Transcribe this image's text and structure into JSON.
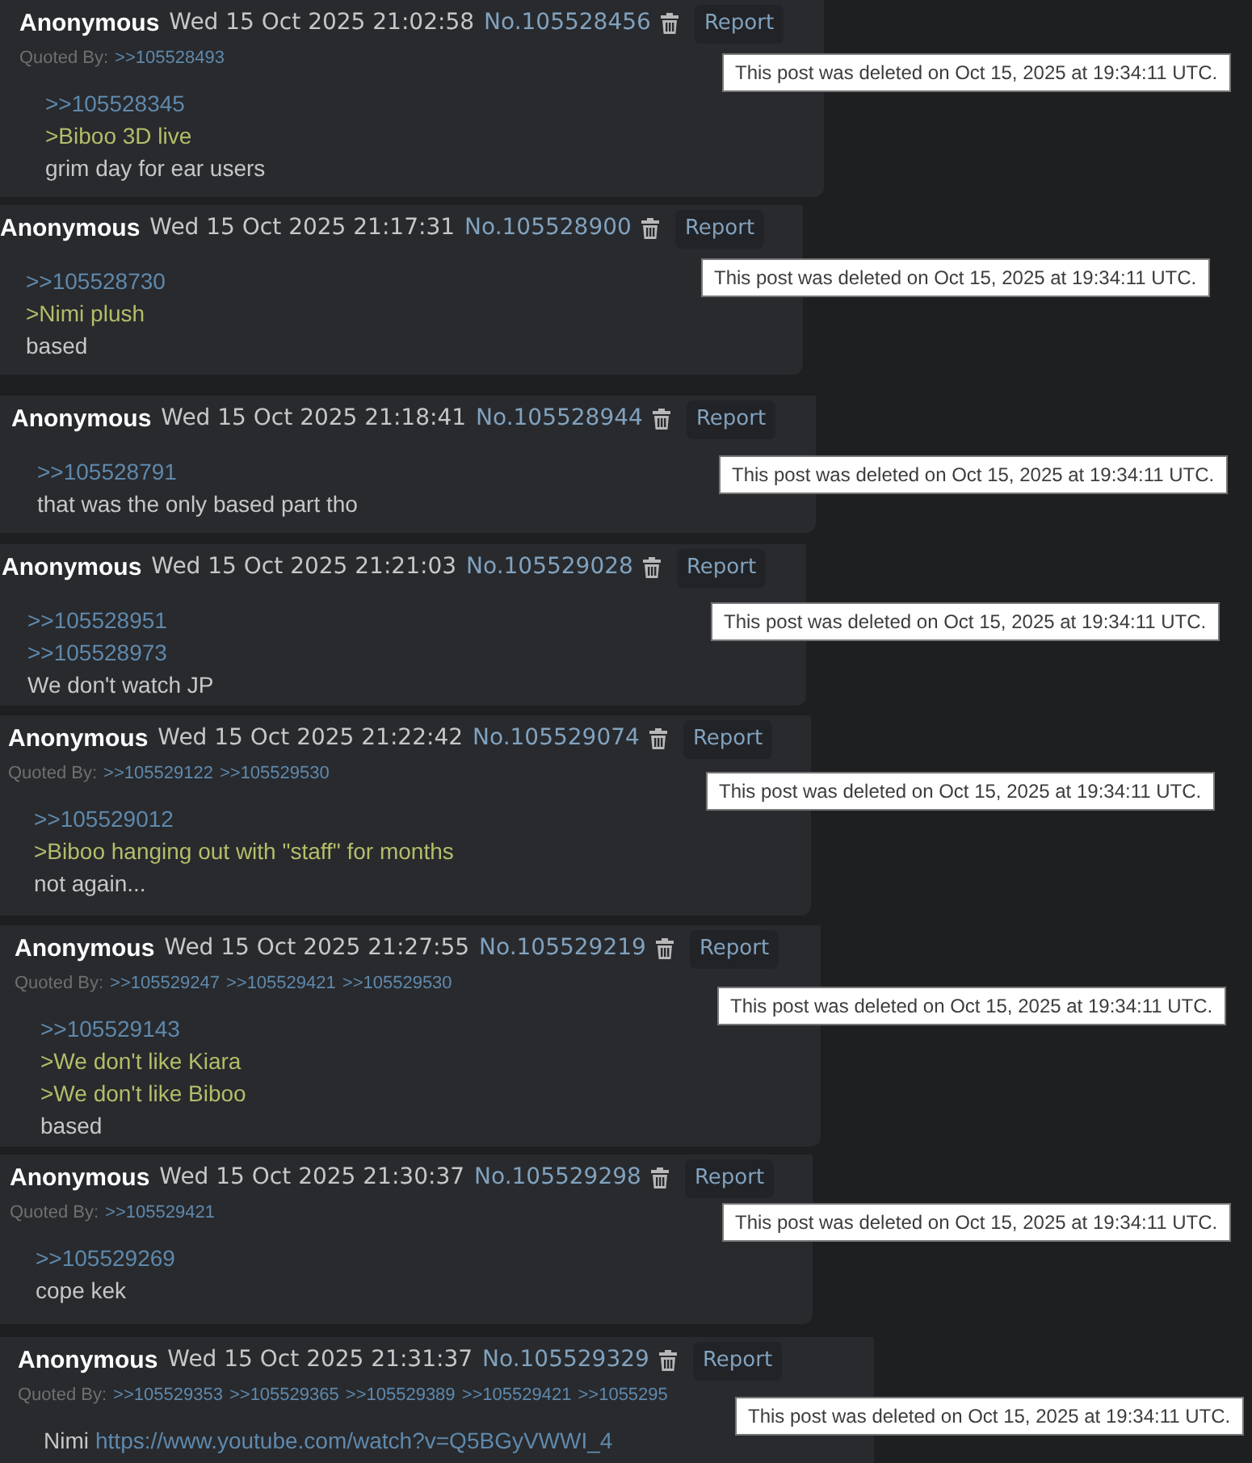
{
  "posts": [
    {
      "name": "Anonymous",
      "date": "Wed 15 Oct 2025 21:02:58",
      "number": "No.105528456",
      "report": "Report",
      "quoted_by_label": "Quoted By:",
      "quoted_by": [
        ">>105528493"
      ],
      "lines": [
        [
          {
            "kind": "quotelink",
            "text": ">>105528345"
          }
        ],
        [
          {
            "kind": "greentext",
            "text": ">Biboo 3D live"
          }
        ],
        [
          {
            "kind": "text",
            "text": "grim day for ear users"
          }
        ]
      ],
      "tooltip": "This post was deleted on Oct 15, 2025 at 19:34:11 UTC."
    },
    {
      "name": "Anonymous",
      "date": "Wed 15 Oct 2025 21:17:31",
      "number": "No.105528900",
      "report": "Report",
      "lines": [
        [
          {
            "kind": "quotelink",
            "text": ">>105528730"
          }
        ],
        [
          {
            "kind": "greentext",
            "text": ">Nimi plush"
          }
        ],
        [
          {
            "kind": "text",
            "text": "based"
          }
        ]
      ],
      "tooltip": "This post was deleted on Oct 15, 2025 at 19:34:11 UTC."
    },
    {
      "name": "Anonymous",
      "date": "Wed 15 Oct 2025 21:18:41",
      "number": "No.105528944",
      "report": "Report",
      "lines": [
        [
          {
            "kind": "quotelink",
            "text": ">>105528791"
          }
        ],
        [
          {
            "kind": "text",
            "text": "that was the only based part tho"
          }
        ]
      ],
      "tooltip": "This post was deleted on Oct 15, 2025 at 19:34:11 UTC."
    },
    {
      "name": "Anonymous",
      "date": "Wed 15 Oct 2025 21:21:03",
      "number": "No.105529028",
      "report": "Report",
      "lines": [
        [
          {
            "kind": "quotelink",
            "text": ">>105528951"
          }
        ],
        [
          {
            "kind": "quotelink",
            "text": ">>105528973"
          }
        ],
        [
          {
            "kind": "text",
            "text": "We don't watch JP"
          }
        ]
      ],
      "tooltip": "This post was deleted on Oct 15, 2025 at 19:34:11 UTC."
    },
    {
      "name": "Anonymous",
      "date": "Wed 15 Oct 2025 21:22:42",
      "number": "No.105529074",
      "report": "Report",
      "quoted_by_label": "Quoted By:",
      "quoted_by": [
        ">>105529122",
        ">>105529530"
      ],
      "lines": [
        [
          {
            "kind": "quotelink",
            "text": ">>105529012"
          }
        ],
        [
          {
            "kind": "greentext",
            "text": ">Biboo hanging out with \"staff\" for months"
          }
        ],
        [
          {
            "kind": "text",
            "text": "not again..."
          }
        ]
      ],
      "tooltip": "This post was deleted on Oct 15, 2025 at 19:34:11 UTC."
    },
    {
      "name": "Anonymous",
      "date": "Wed 15 Oct 2025 21:27:55",
      "number": "No.105529219",
      "report": "Report",
      "quoted_by_label": "Quoted By:",
      "quoted_by": [
        ">>105529247",
        ">>105529421",
        ">>105529530"
      ],
      "lines": [
        [
          {
            "kind": "quotelink",
            "text": ">>105529143"
          }
        ],
        [
          {
            "kind": "greentext",
            "text": ">We don't like Kiara"
          }
        ],
        [
          {
            "kind": "greentext",
            "text": ">We don't like Biboo"
          }
        ],
        [
          {
            "kind": "text",
            "text": "based"
          }
        ]
      ],
      "tooltip": "This post was deleted on Oct 15, 2025 at 19:34:11 UTC."
    },
    {
      "name": "Anonymous",
      "date": "Wed 15 Oct 2025 21:30:37",
      "number": "No.105529298",
      "report": "Report",
      "quoted_by_label": "Quoted By:",
      "quoted_by": [
        ">>105529421"
      ],
      "lines": [
        [
          {
            "kind": "quotelink",
            "text": ">>105529269"
          }
        ],
        [
          {
            "kind": "text",
            "text": "cope kek"
          }
        ]
      ],
      "tooltip": "This post was deleted on Oct 15, 2025 at 19:34:11 UTC."
    },
    {
      "name": "Anonymous",
      "date": "Wed 15 Oct 2025 21:31:37",
      "number": "No.105529329",
      "report": "Report",
      "quoted_by_label": "Quoted By:",
      "quoted_by": [
        ">>105529353",
        ">>105529365",
        ">>105529389",
        ">>105529421",
        ">>1055295"
      ],
      "lines": [
        [
          {
            "kind": "text",
            "text": "Nimi"
          },
          {
            "kind": "url",
            "text": "https://www.youtube.com/watch?v=Q5BGyVWWI_4"
          }
        ]
      ],
      "tooltip": "This post was deleted on Oct 15, 2025 at 19:34:11 UTC."
    }
  ]
}
